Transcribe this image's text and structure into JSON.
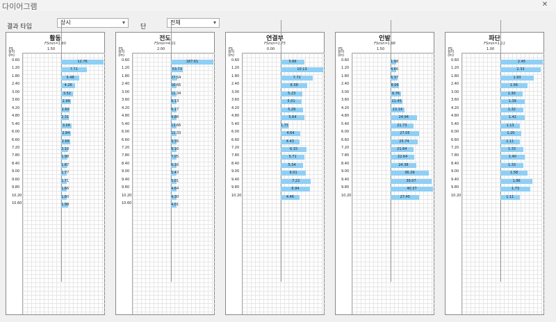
{
  "window": {
    "title": "다이어그램"
  },
  "toolbar": {
    "result_type_label": "결과 타입",
    "result_type_value": "상시",
    "stage_label": "단",
    "stage_value": "전체"
  },
  "colors": {
    "bar": "#8fcff5"
  },
  "panels": [
    {
      "title": "활동",
      "fsmin": "FSmin=1.60",
      "fs_label": "FS",
      "fs_value": "1.50",
      "col_label": "깊이\n(m)",
      "rows": [
        {
          "depth": "0.60",
          "value": "12.76"
        },
        {
          "depth": "1.20",
          "value": "7.71"
        },
        {
          "depth": "1.80",
          "value": "5.48"
        },
        {
          "depth": "2.40",
          "value": "4.26"
        },
        {
          "depth": "3.00",
          "value": "3.52"
        },
        {
          "depth": "3.60",
          "value": "2.99"
        },
        {
          "depth": "4.20",
          "value": "2.60"
        },
        {
          "depth": "4.80",
          "value": "2.31"
        },
        {
          "depth": "5.40",
          "value": "3.04"
        },
        {
          "depth": "6.00",
          "value": "2.84"
        },
        {
          "depth": "6.60",
          "value": "2.66"
        },
        {
          "depth": "7.20",
          "value": "2.10"
        },
        {
          "depth": "7.80",
          "value": "1.98"
        },
        {
          "depth": "8.40",
          "value": "1.87"
        },
        {
          "depth": "9.00",
          "value": "1.77"
        },
        {
          "depth": "9.60",
          "value": "1.71"
        },
        {
          "depth": "9.80",
          "value": "1.66"
        },
        {
          "depth": "10.20",
          "value": "1.60"
        },
        {
          "depth": "10.60",
          "value": "1.99"
        }
      ]
    },
    {
      "title": "전도",
      "fsmin": "FSmin=4.01",
      "fs_label": "FS",
      "fs_value": "2.00",
      "col_label": "깊이\n(m)",
      "rows": [
        {
          "depth": "0.60",
          "value": "187.61"
        },
        {
          "depth": "1.20",
          "value": "53.73"
        },
        {
          "depth": "1.80",
          "value": "27.54"
        },
        {
          "depth": "2.40",
          "value": "16.66"
        },
        {
          "depth": "3.00",
          "value": "11.34"
        },
        {
          "depth": "3.60",
          "value": "8.13"
        },
        {
          "depth": "4.20",
          "value": "6.17"
        },
        {
          "depth": "4.80",
          "value": "4.86"
        },
        {
          "depth": "5.40",
          "value": "13.66"
        },
        {
          "depth": "6.00",
          "value": "11.33"
        },
        {
          "depth": "6.60",
          "value": "9.35"
        },
        {
          "depth": "7.20",
          "value": "8.16"
        },
        {
          "depth": "7.80",
          "value": "7.05"
        },
        {
          "depth": "8.40",
          "value": "6.16"
        },
        {
          "depth": "9.00",
          "value": "5.43"
        },
        {
          "depth": "9.40",
          "value": "5.01"
        },
        {
          "depth": "9.80",
          "value": "4.64"
        },
        {
          "depth": "10.20",
          "value": "4.30"
        },
        {
          "depth": "10.60",
          "value": "4.01"
        }
      ]
    },
    {
      "title": "연결부",
      "fsmin": "FSmin=1.75",
      "fs_label": "FS",
      "fs_value": "0.00",
      "col_label": "깊이\n(m)",
      "rows": [
        {
          "depth": "0.60",
          "value": "5.66"
        },
        {
          "depth": "1.20",
          "value": "10.13"
        },
        {
          "depth": "1.80",
          "value": "7.72"
        },
        {
          "depth": "2.40",
          "value": "6.38"
        },
        {
          "depth": "3.00",
          "value": "5.23"
        },
        {
          "depth": "3.60",
          "value": "5.01"
        },
        {
          "depth": "4.20",
          "value": "5.26"
        },
        {
          "depth": "4.80",
          "value": "5.64"
        },
        {
          "depth": "5.40",
          "value": "1.75"
        },
        {
          "depth": "6.00",
          "value": "4.64"
        },
        {
          "depth": "6.60",
          "value": "4.43"
        },
        {
          "depth": "7.20",
          "value": "6.15"
        },
        {
          "depth": "7.80",
          "value": "5.71"
        },
        {
          "depth": "8.40",
          "value": "5.34"
        },
        {
          "depth": "9.00",
          "value": "6.01"
        },
        {
          "depth": "9.40",
          "value": "7.22"
        },
        {
          "depth": "9.80",
          "value": "6.94"
        },
        {
          "depth": "10.20",
          "value": "4.46"
        }
      ]
    },
    {
      "title": "인발",
      "fsmin": "FSmin=1.98",
      "fs_label": "FS",
      "fs_value": "1.50",
      "col_label": "깊이\n(m)",
      "rows": [
        {
          "depth": "0.60",
          "value": "1.98"
        },
        {
          "depth": "1.20",
          "value": "4.66"
        },
        {
          "depth": "1.80",
          "value": "6.37"
        },
        {
          "depth": "2.40",
          "value": "8.06"
        },
        {
          "depth": "3.00",
          "value": "9.76"
        },
        {
          "depth": "3.60",
          "value": "11.45"
        },
        {
          "depth": "4.20",
          "value": "13.14"
        },
        {
          "depth": "4.80",
          "value": "24.94"
        },
        {
          "depth": "5.40",
          "value": "21.73"
        },
        {
          "depth": "6.00",
          "value": "27.05"
        },
        {
          "depth": "6.60",
          "value": "25.74"
        },
        {
          "depth": "7.20",
          "value": "21.64"
        },
        {
          "depth": "7.80",
          "value": "22.64"
        },
        {
          "depth": "8.40",
          "value": "24.38"
        },
        {
          "depth": "9.00",
          "value": "36.29"
        },
        {
          "depth": "9.40",
          "value": "39.07"
        },
        {
          "depth": "9.80",
          "value": "40.37"
        },
        {
          "depth": "10.20",
          "value": "27.45"
        }
      ]
    },
    {
      "title": "파단",
      "fsmin": "FSmin=1.11",
      "fs_label": "FS",
      "fs_value": "1.00",
      "col_label": "깊이\n(m)",
      "rows": [
        {
          "depth": "0.60",
          "value": "2.45"
        },
        {
          "depth": "1.20",
          "value": "2.33"
        },
        {
          "depth": "1.80",
          "value": "1.93"
        },
        {
          "depth": "2.40",
          "value": "1.56"
        },
        {
          "depth": "3.00",
          "value": "1.30"
        },
        {
          "depth": "3.60",
          "value": "1.39"
        },
        {
          "depth": "4.20",
          "value": "1.32"
        },
        {
          "depth": "4.80",
          "value": "1.41"
        },
        {
          "depth": "5.40",
          "value": "1.13"
        },
        {
          "depth": "6.00",
          "value": "1.20"
        },
        {
          "depth": "6.60",
          "value": "1.11"
        },
        {
          "depth": "7.20",
          "value": "1.33"
        },
        {
          "depth": "7.80",
          "value": "1.40"
        },
        {
          "depth": "8.40",
          "value": "1.33"
        },
        {
          "depth": "9.00",
          "value": "1.58"
        },
        {
          "depth": "9.40",
          "value": "1.86"
        },
        {
          "depth": "9.80",
          "value": "1.73"
        },
        {
          "depth": "10.20",
          "value": "1.11"
        }
      ]
    }
  ]
}
